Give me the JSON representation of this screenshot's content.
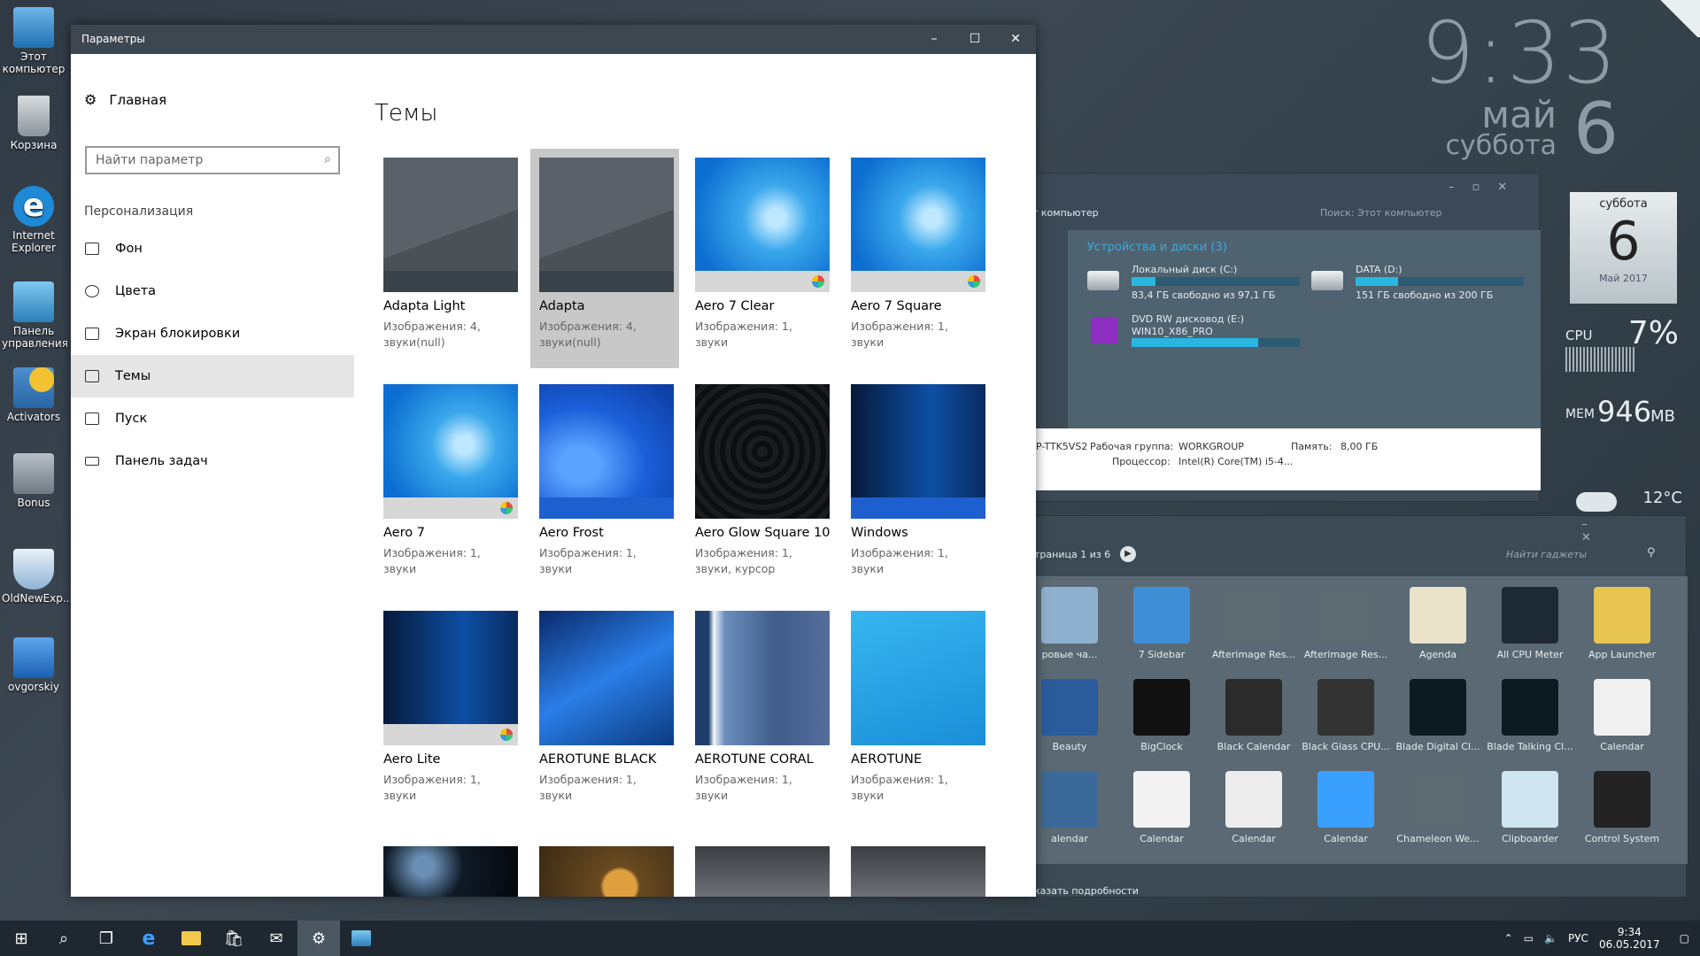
{
  "desktop": {
    "icons": [
      {
        "label": "Этот компьютер"
      },
      {
        "label": "Корзина"
      },
      {
        "label": "Internet Explorer"
      },
      {
        "label": "Панель управления"
      },
      {
        "label": "Activators"
      },
      {
        "label": "Bonus"
      },
      {
        "label": "OldNewExp..."
      },
      {
        "label": "ovgorskiy"
      }
    ]
  },
  "clock": {
    "time": "9:33",
    "month": "май",
    "weekday": "суббота",
    "day": "6"
  },
  "calendar_widget": {
    "weekday": "суббота",
    "day": "6",
    "month_year": "Май 2017"
  },
  "cpu_widget": {
    "label": "CPU",
    "value": "7%"
  },
  "mem_widget": {
    "label": "MEM",
    "value": "946",
    "unit": "MB"
  },
  "weather_widget": {
    "temp": "12°C"
  },
  "explorer": {
    "title": "т компьютер",
    "search_placeholder": "Поиск: Этот компьютер",
    "section": "Устройства и диски (3)",
    "drives": [
      {
        "name": "Локальный диск (C:)",
        "info": "83,4 ГБ свободно из 97,1 ГБ",
        "fill": 0.14
      },
      {
        "name": "DATA (D:)",
        "info": "151 ГБ свободно из 200 ГБ",
        "fill": 0.25
      },
      {
        "name": "DVD RW дисковод (E:)",
        "info": "WIN10_X86_PRO",
        "fill": 0.75
      }
    ],
    "footer": {
      "computer": "P-TTK5VS2",
      "workgroup_label": "Рабочая группа:",
      "workgroup": "WORKGROUP",
      "memory_label": "Память:",
      "memory": "8,00 ГБ",
      "cpu_label": "Процессор:",
      "cpu": "Intel(R) Core(TM) i5-4..."
    }
  },
  "gadgets": {
    "page": "траница 1 из 6",
    "search_placeholder": "Найти гаджеты",
    "show_details": "казать подробности",
    "rows": [
      [
        "ровые ча...",
        "7 Sidebar",
        "Afterimage Res...",
        "Afterimage Res...",
        "Agenda",
        "All CPU Meter",
        "App Launcher"
      ],
      [
        "Beauty",
        "BigClock",
        "Black Calendar",
        "Black Glass CPU...",
        "Blade Digital Cl...",
        "Blade Talking Cl...",
        "Calendar"
      ],
      [
        "alendar",
        "Calendar",
        "Calendar",
        "Calendar",
        "Chameleon We...",
        "Clipboarder",
        "Control System"
      ]
    ]
  },
  "settings": {
    "window_title": "Параметры",
    "home": "Главная",
    "search_placeholder": "Найти параметр",
    "category": "Персонализация",
    "nav": [
      {
        "label": "Фон"
      },
      {
        "label": "Цвета"
      },
      {
        "label": "Экран блокировки"
      },
      {
        "label": "Темы"
      },
      {
        "label": "Пуск"
      },
      {
        "label": "Панель задач"
      }
    ],
    "page_title": "Темы",
    "themes": [
      {
        "name": "Adapta Light",
        "desc": "Изображения: 4, звуки(null)"
      },
      {
        "name": "Adapta",
        "desc": "Изображения: 4, звуки(null)"
      },
      {
        "name": "Aero 7 Clear",
        "desc": "Изображения: 1, звуки"
      },
      {
        "name": "Aero 7 Square",
        "desc": "Изображения: 1, звуки"
      },
      {
        "name": "Aero 7",
        "desc": "Изображения: 1, звуки"
      },
      {
        "name": "Aero Frost",
        "desc": "Изображения: 1, звуки"
      },
      {
        "name": "Aero Glow Square 10",
        "desc": "Изображения: 1, звуки, курсор"
      },
      {
        "name": "Windows",
        "desc": "Изображения: 1, звуки"
      },
      {
        "name": "Aero Lite",
        "desc": "Изображения: 1, звуки"
      },
      {
        "name": "AEROTUNE BLACK",
        "desc": "Изображения: 1, звуки"
      },
      {
        "name": "AEROTUNE CORAL",
        "desc": "Изображения: 1, звуки"
      },
      {
        "name": "AEROTUNE",
        "desc": "Изображения: 1, звуки"
      }
    ]
  },
  "taskbar": {
    "lang": "РУС",
    "time": "9:34",
    "date": "06.05.2017"
  }
}
